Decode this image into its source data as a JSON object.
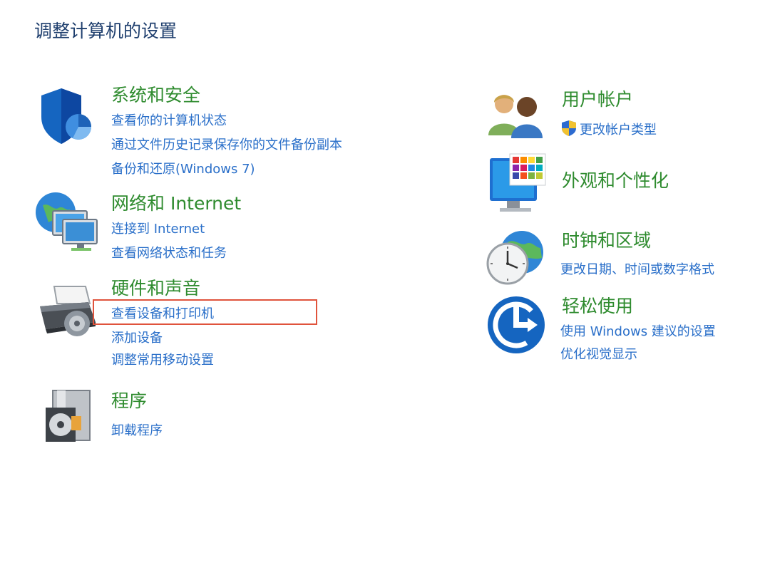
{
  "page": {
    "title": "调整计算机的设置"
  },
  "left_column": [
    {
      "id": "system-security",
      "title": "系统和安全",
      "icon": "shield-icon",
      "links": [
        "查看你的计算机状态",
        "通过文件历史记录保存你的文件备份副本",
        "备份和还原(Windows 7)"
      ]
    },
    {
      "id": "network",
      "title": "网络和 Internet",
      "icon": "network-globe-icon",
      "links": [
        "连接到 Internet",
        "查看网络状态和任务"
      ]
    },
    {
      "id": "hardware-sound",
      "title": "硬件和声音",
      "icon": "printer-icon",
      "links": [
        "查看设备和打印机",
        "添加设备",
        "调整常用移动设置"
      ]
    },
    {
      "id": "programs",
      "title": "程序",
      "icon": "programs-disc-icon",
      "links": [
        "卸载程序"
      ]
    }
  ],
  "right_column": [
    {
      "id": "user-accounts",
      "title": "用户帐户",
      "icon": "users-icon",
      "links": [
        "更改帐户类型"
      ],
      "link_icon": "uac-shield-icon"
    },
    {
      "id": "appearance",
      "title": "外观和个性化",
      "icon": "monitor-palette-icon",
      "links": []
    },
    {
      "id": "clock-region",
      "title": "时钟和区域",
      "icon": "clock-globe-icon",
      "links": [
        "更改日期、时间或数字格式"
      ]
    },
    {
      "id": "ease-of-access",
      "title": "轻松使用",
      "icon": "ease-of-access-icon",
      "links": [
        "使用 Windows 建议的设置",
        "优化视觉显示"
      ]
    }
  ],
  "highlight": {
    "target": "查看设备和打印机",
    "color": "#e0533c"
  },
  "colors": {
    "title": "#1f3f6e",
    "category": "#2e8b2e",
    "link": "#2a6fc9"
  }
}
